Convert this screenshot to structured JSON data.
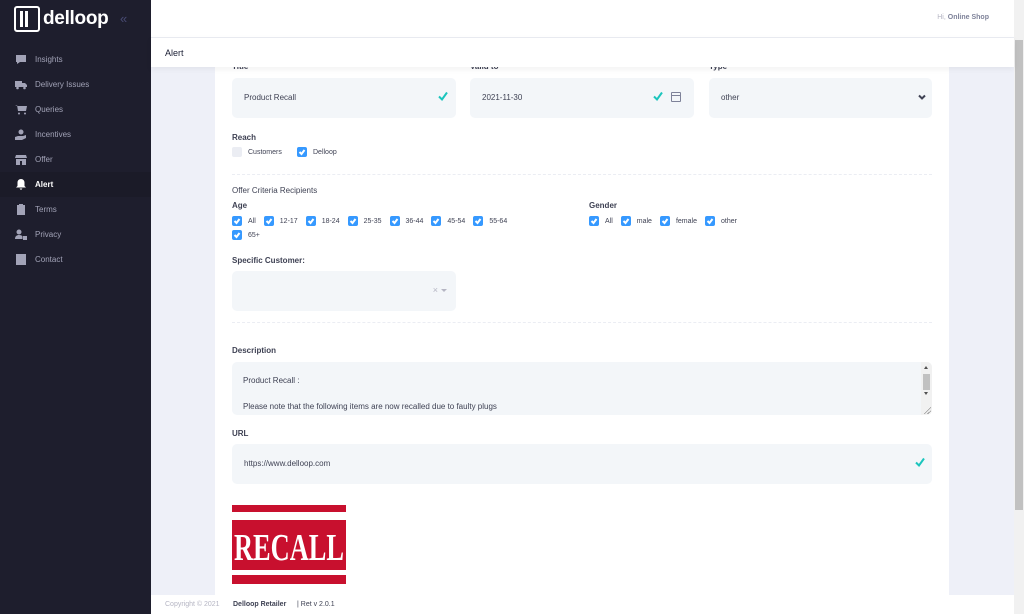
{
  "brand": {
    "name": "delloop"
  },
  "sidebar": {
    "items": [
      {
        "label": "Insights",
        "icon": "chat-chart-icon",
        "active": false
      },
      {
        "label": "Delivery Issues",
        "icon": "truck-icon",
        "active": false
      },
      {
        "label": "Queries",
        "icon": "cart-icon",
        "active": false
      },
      {
        "label": "Incentives",
        "icon": "hand-coin-icon",
        "active": false
      },
      {
        "label": "Offer",
        "icon": "store-icon",
        "active": false
      },
      {
        "label": "Alert",
        "icon": "bell-icon",
        "active": true
      },
      {
        "label": "Terms",
        "icon": "clipboard-icon",
        "active": false
      },
      {
        "label": "Privacy",
        "icon": "user-lock-icon",
        "active": false
      },
      {
        "label": "Contact",
        "icon": "phone-book-icon",
        "active": false
      }
    ]
  },
  "header": {
    "greeting": "Hi,",
    "user": "Online Shop"
  },
  "subheader": {
    "title": "Alert"
  },
  "form": {
    "title": {
      "label": "Title",
      "value": "Product Recall"
    },
    "valid_to": {
      "label": "Valid to",
      "value": "2021-11-30"
    },
    "type": {
      "label": "Type",
      "value": "other"
    },
    "reach": {
      "label": "Reach",
      "options": [
        {
          "label": "Customers",
          "checked": false
        },
        {
          "label": "Delloop",
          "checked": true
        }
      ]
    },
    "criteria_heading": "Offer Criteria Recipients",
    "age": {
      "label": "Age",
      "options": [
        "All",
        "12-17",
        "18-24",
        "25-35",
        "36-44",
        "45-54",
        "55-64",
        "65+"
      ]
    },
    "gender": {
      "label": "Gender",
      "options": [
        "All",
        "male",
        "female",
        "other"
      ]
    },
    "specific_customer": {
      "label": "Specific Customer:",
      "clear": "×"
    },
    "description": {
      "label": "Description",
      "line1": "Product Recall :",
      "line2": "Please note that the following items are now recalled due to faulty plugs"
    },
    "url": {
      "label": "URL",
      "value": "https://www.delloop.com"
    },
    "image": {
      "text": "RECALL"
    }
  },
  "footer": {
    "copyright": "Copyright © 2021",
    "app": "Delloop Retailer",
    "version": "| Ret v 2.0.1"
  },
  "colors": {
    "accent": "#3699ff",
    "success": "#1bc5bd",
    "sidebar": "#1e1e2d",
    "recall": "#c8102e"
  }
}
